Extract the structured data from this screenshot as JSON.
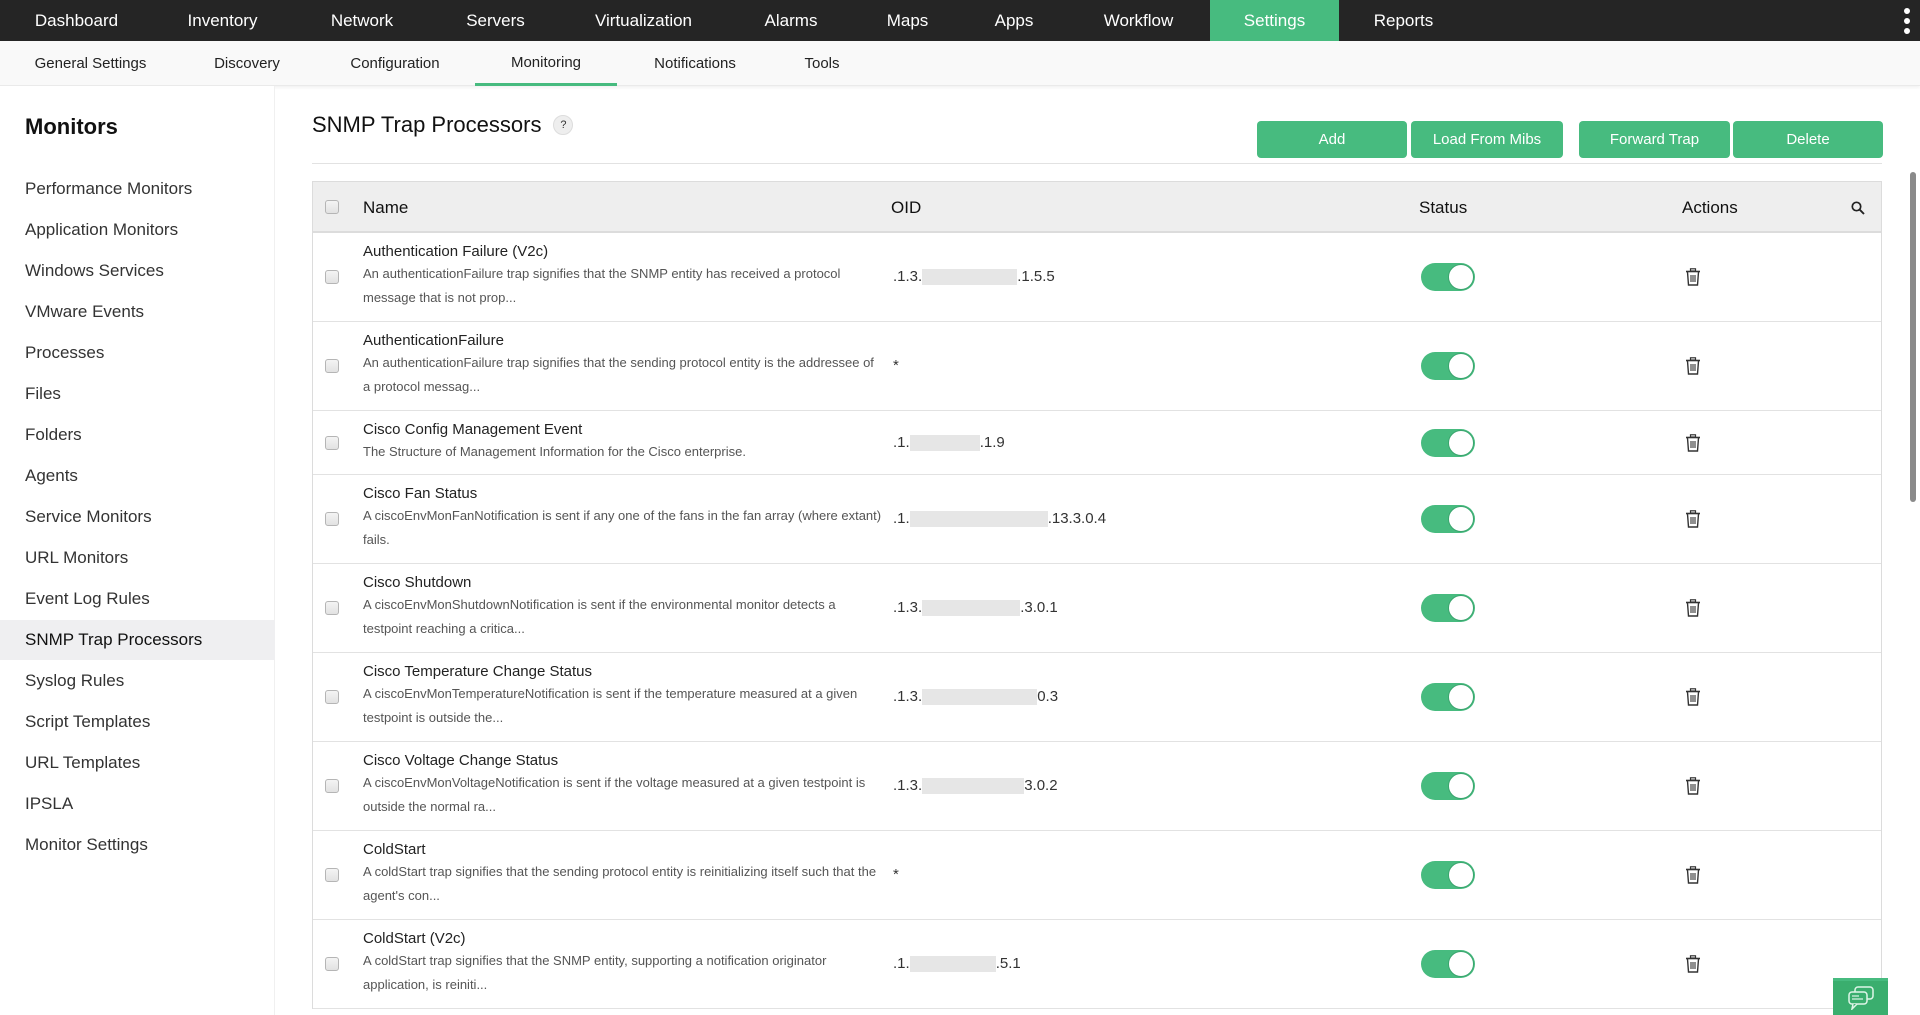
{
  "topnav": {
    "tabs": [
      {
        "label": "Dashboard"
      },
      {
        "label": "Inventory"
      },
      {
        "label": "Network"
      },
      {
        "label": "Servers"
      },
      {
        "label": "Virtualization"
      },
      {
        "label": "Alarms"
      },
      {
        "label": "Maps"
      },
      {
        "label": "Apps"
      },
      {
        "label": "Workflow"
      },
      {
        "label": "Settings",
        "active": true
      },
      {
        "label": "Reports"
      }
    ],
    "more_icon": "kebab-vertical-icon"
  },
  "subnav": {
    "tabs": [
      {
        "label": "General Settings"
      },
      {
        "label": "Discovery"
      },
      {
        "label": "Configuration"
      },
      {
        "label": "Monitoring",
        "active": true
      },
      {
        "label": "Notifications"
      },
      {
        "label": "Tools"
      }
    ]
  },
  "sidebar": {
    "title": "Monitors",
    "items": [
      {
        "label": "Performance Monitors"
      },
      {
        "label": "Application Monitors"
      },
      {
        "label": "Windows Services"
      },
      {
        "label": "VMware Events"
      },
      {
        "label": "Processes"
      },
      {
        "label": "Files"
      },
      {
        "label": "Folders"
      },
      {
        "label": "Agents"
      },
      {
        "label": "Service Monitors"
      },
      {
        "label": "URL Monitors"
      },
      {
        "label": "Event Log Rules"
      },
      {
        "label": "SNMP Trap Processors",
        "active": true
      },
      {
        "label": "Syslog Rules"
      },
      {
        "label": "Script Templates"
      },
      {
        "label": "URL Templates"
      },
      {
        "label": "IPSLA"
      },
      {
        "label": "Monitor Settings"
      }
    ]
  },
  "page": {
    "title": "SNMP Trap Processors",
    "help_label": "?",
    "buttons": {
      "add": "Add",
      "load_from_mibs": "Load From Mibs",
      "forward_trap": "Forward Trap",
      "delete": "Delete"
    }
  },
  "table": {
    "columns": {
      "name": "Name",
      "oid": "OID",
      "status": "Status",
      "actions": "Actions"
    },
    "rows": [
      {
        "name": "Authentication Failure (V2c)",
        "description": "An authenticationFailure trap signifies that the SNMP entity has received a protocol message that is not prop...",
        "oid_prefix": ".1.3.",
        "oid_suffix": ".1.5.5",
        "oid_redacted": true,
        "status_enabled": true
      },
      {
        "name": "AuthenticationFailure",
        "description": "An authenticationFailure trap signifies that the sending protocol entity is the addressee of a protocol messag...",
        "oid_prefix": "*",
        "oid_suffix": "",
        "oid_redacted": false,
        "status_enabled": true
      },
      {
        "name": "Cisco Config Management Event",
        "description": "The Structure of Management Information for the Cisco enterprise.",
        "oid_prefix": ".1.",
        "oid_suffix": ".1.9",
        "oid_redacted": true,
        "status_enabled": true
      },
      {
        "name": "Cisco Fan Status",
        "description": "A ciscoEnvMonFanNotification is sent if any one of the fans in the fan array (where extant) fails.",
        "oid_prefix": ".1.",
        "oid_suffix": ".13.3.0.4",
        "oid_redacted": true,
        "status_enabled": true
      },
      {
        "name": "Cisco Shutdown",
        "description": "A ciscoEnvMonShutdownNotification is sent if the environmental monitor detects a testpoint reaching a critica...",
        "oid_prefix": ".1.3.",
        "oid_suffix": ".3.0.1",
        "oid_redacted": true,
        "status_enabled": true
      },
      {
        "name": "Cisco Temperature Change Status",
        "description": "A ciscoEnvMonTemperatureNotification is sent if the temperature measured at a given testpoint is outside the...",
        "oid_prefix": ".1.3.",
        "oid_suffix": "0.3",
        "oid_redacted": true,
        "status_enabled": true
      },
      {
        "name": "Cisco Voltage Change Status",
        "description": "A ciscoEnvMonVoltageNotification is sent if the voltage measured at a given testpoint is outside the normal ra...",
        "oid_prefix": ".1.3.",
        "oid_suffix": "3.0.2",
        "oid_redacted": true,
        "status_enabled": true
      },
      {
        "name": "ColdStart",
        "description": "A coldStart trap signifies that the sending protocol entity is reinitializing itself such that the agent's con...",
        "oid_prefix": "*",
        "oid_suffix": "",
        "oid_redacted": false,
        "status_enabled": true
      },
      {
        "name": "ColdStart (V2c)",
        "description": "A coldStart trap signifies that the SNMP entity, supporting a notification originator application, is reiniti...",
        "oid_prefix": ".1.",
        "oid_suffix": ".5.1",
        "oid_redacted": true,
        "status_enabled": true
      }
    ]
  },
  "colors": {
    "accent": "#47bb7f",
    "topnav_bg": "#252525",
    "subnav_bg": "#f9f9f9",
    "table_header_bg": "#eeeeee",
    "sidebar_active_bg": "#efeff1"
  },
  "chat_widget_icon": "chat-bubbles-icon"
}
